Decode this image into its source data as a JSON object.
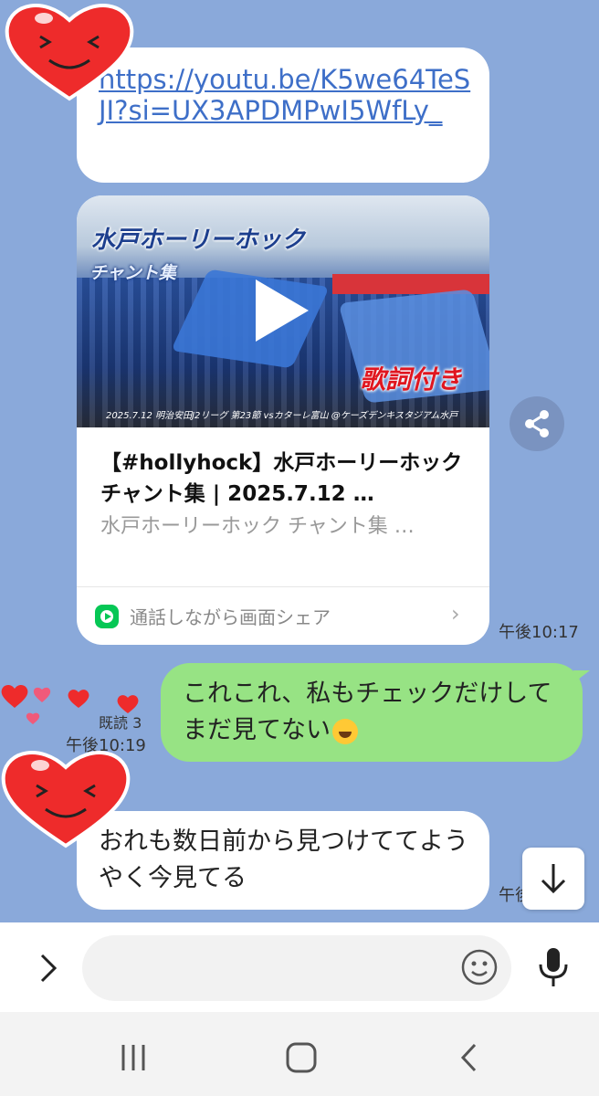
{
  "messages": {
    "link_message": {
      "url": "https://youtu.be/K5we64TeSJI?si=UX3APDMPwI5WfLy_"
    },
    "link_preview": {
      "thumbnail_title": "水戸ホーリーホック",
      "thumbnail_subtitle": "チャント集",
      "thumbnail_tag": "歌詞付き",
      "thumbnail_caption": "2025.7.12 明治安田J2リーグ 第23節 vsカターレ富山 @ケーズデンキスタジアム水戸",
      "title": "【#hollyhock】水戸ホーリーホック チャント集 | 2025.7.12 …",
      "description": "水戸ホーリーホック チャント集 …",
      "footer_action": "通話しながら画面シェア",
      "timestamp": "午後10:17"
    },
    "sent_message": {
      "text": "これこれ、私もチェックだけしてまだ見てない",
      "read_status": "既読 3",
      "timestamp": "午後10:19"
    },
    "received_message": {
      "text": "おれも数日前から見つけててようやく今見てる",
      "timestamp": "午後"
    }
  },
  "input": {
    "placeholder": ""
  },
  "icons": {
    "share": "share-icon",
    "play": "play-icon",
    "scroll_down": "arrow-down-icon",
    "expand": "chevron-right-icon",
    "emoji": "smiley-icon",
    "mic": "microphone-icon",
    "nav_recent": "recent-apps-icon",
    "nav_home": "home-icon",
    "nav_back": "back-icon"
  },
  "colors": {
    "chat_background": "#8aa9da",
    "sent_bubble": "#97e384",
    "link": "#3e6fc8",
    "accent_green": "#06c755"
  }
}
